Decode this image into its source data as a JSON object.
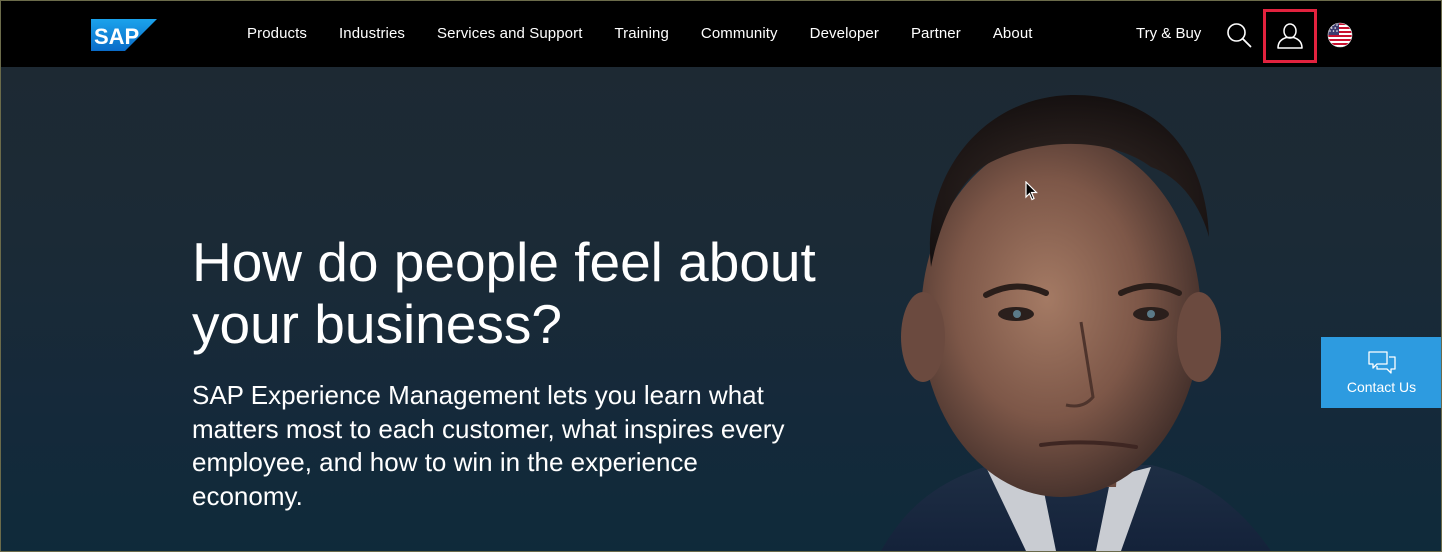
{
  "header": {
    "logo_text": "SAP",
    "nav": [
      {
        "label": "Products"
      },
      {
        "label": "Industries"
      },
      {
        "label": "Services and Support"
      },
      {
        "label": "Training"
      },
      {
        "label": "Community"
      },
      {
        "label": "Developer"
      },
      {
        "label": "Partner"
      },
      {
        "label": "About"
      }
    ],
    "try_buy": "Try & Buy",
    "icons": {
      "search": "search-icon",
      "user": "user-icon",
      "flag": "us-flag-icon"
    },
    "highlight_color": "#e2223e"
  },
  "hero": {
    "title": "How do people feel about your business?",
    "description": "SAP Experience Management lets you learn what matters most to each customer, what inspires every employee, and how to win in the experience economy."
  },
  "contact": {
    "label": "Contact Us",
    "icon": "chat-bubbles-icon",
    "color": "#2d9be0"
  },
  "colors": {
    "nav_background": "#000000",
    "brand_blue": "#0a74d4"
  }
}
